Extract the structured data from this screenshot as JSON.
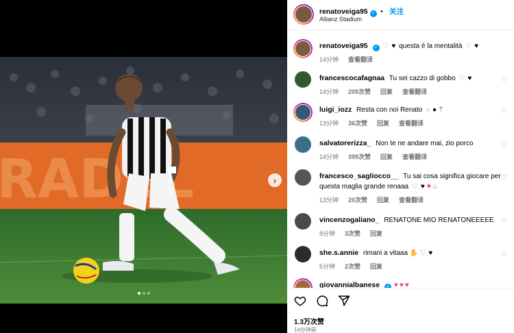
{
  "post": {
    "username": "renatoveiga95",
    "follow_label": "关注",
    "location": "Allianz Stadium",
    "caption_text": "questa è la mentalità",
    "caption_time": "14分钟",
    "caption_translate": "查看翻译"
  },
  "comments": [
    {
      "user": "francescocafagnaa",
      "text": "Tu sei cazzo di gobbo",
      "time": "14分钟",
      "likes": "209次赞",
      "reply": "回复",
      "translate": "查看翻译"
    },
    {
      "user": "luigi_iozz",
      "text": "Resta con noi Renato",
      "time": "13分钟",
      "likes": "36次赞",
      "reply": "回复",
      "translate": "查看翻译"
    },
    {
      "user": "salvatorerizza_",
      "text": "Non te ne andare mai, zio porco",
      "time": "14分钟",
      "likes": "399次赞",
      "reply": "回复",
      "translate": "查看翻译"
    },
    {
      "user": "francesco_sagliocco__",
      "text": "Tu sai cosa significa giocare per questa maglia grande renaaa",
      "time": "13分钟",
      "likes": "20次赞",
      "reply": "回复",
      "translate": "查看翻译"
    },
    {
      "user": "vincenzogaliano_",
      "text": "RENATONE MIO RENATONEEEEE",
      "time": "8分钟",
      "likes": "3次赞",
      "reply": "回复",
      "translate": ""
    },
    {
      "user": "she.s.annie",
      "text": "rimani a vitaaa",
      "time": "5分钟",
      "likes": "2次赞",
      "reply": "回复",
      "translate": ""
    },
    {
      "user": "giovannialbanese",
      "text": "",
      "time": "",
      "likes": "",
      "reply": "",
      "translate": ""
    }
  ],
  "footer": {
    "likes": "1.3万次赞",
    "time": "14分钟前"
  },
  "icons": [
    "heart-outline-icon",
    "comment-icon",
    "share-icon",
    "verified-icon",
    "chevron-right-icon"
  ],
  "colors": {
    "accent": "#0095f6",
    "heart_red": "#ed4956",
    "meta_gray": "#737373"
  },
  "carousel": {
    "current": 1,
    "total": 3
  }
}
